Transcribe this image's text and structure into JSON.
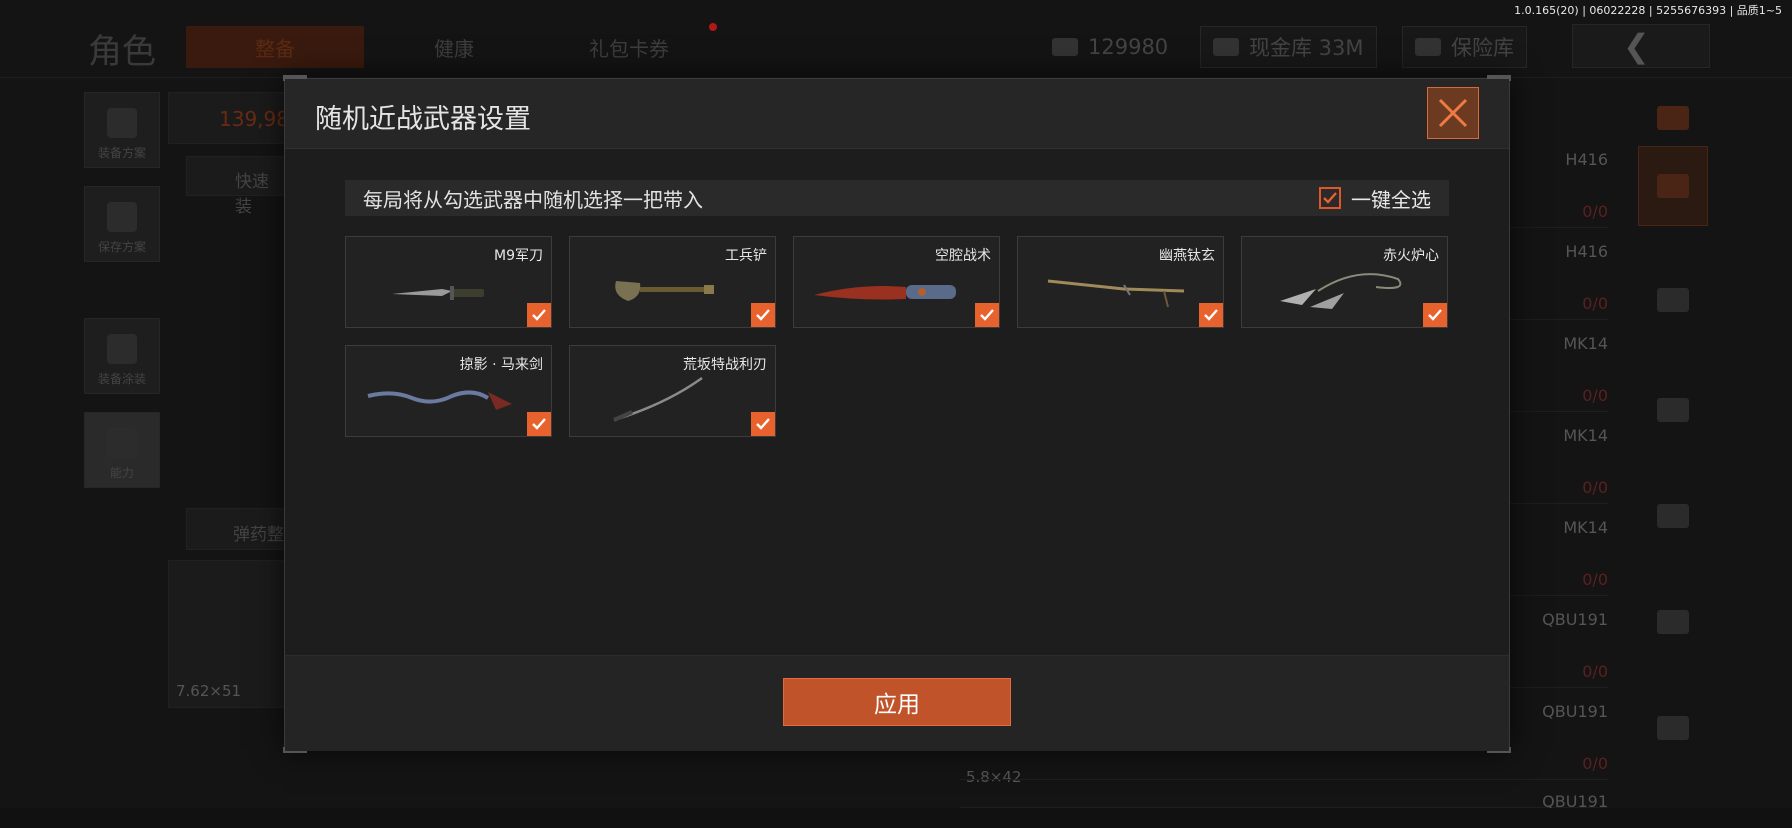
{
  "version": "1.0.165(20) | 06022228 | 5255676393 | 品质1~5",
  "header": {
    "title": "角色",
    "tabs": [
      {
        "label": "整备",
        "active": true
      },
      {
        "label": "健康",
        "active": false
      },
      {
        "label": "礼包卡券",
        "active": false
      }
    ],
    "money": "129980",
    "cash_vault": "现金库 33M",
    "safe": "保险库"
  },
  "left_panel": {
    "items": [
      "装备方案",
      "保存方案",
      "装备涂装",
      "能力"
    ],
    "balance": "139,98",
    "quick_label": "快速装",
    "ammo_label": "弹药整",
    "caliber": "7.62×51"
  },
  "right_list": {
    "rows": [
      {
        "name": "H416",
        "count": "0/0"
      },
      {
        "name": "H416",
        "count": "0/0"
      },
      {
        "name": "MK14",
        "count": "0/0"
      },
      {
        "name": "MK14",
        "count": "0/0"
      },
      {
        "name": "MK14",
        "count": "0/0"
      },
      {
        "name": "QBU191",
        "count": "0/0"
      },
      {
        "name": "QBU191",
        "count": "0/0"
      },
      {
        "name": "QBU191",
        "count": ""
      }
    ],
    "caliber2": "5.8×42"
  },
  "modal": {
    "title": "随机近战武器设置",
    "info": "每局将从勾选武器中随机选择一把带入",
    "select_all_label": "一键全选",
    "select_all_checked": true,
    "weapons": [
      {
        "name": "M9军刀",
        "checked": true
      },
      {
        "name": "工兵铲",
        "checked": true
      },
      {
        "name": "空腔战术",
        "checked": true
      },
      {
        "name": "幽燕钛玄",
        "checked": true
      },
      {
        "name": "赤火炉心",
        "checked": true
      },
      {
        "name": "掠影 · 马来剑",
        "checked": true
      },
      {
        "name": "荒坂特战利刃",
        "checked": true
      }
    ],
    "apply_label": "应用"
  },
  "colors": {
    "accent": "#e8622e",
    "accent_dark": "#c0532a"
  }
}
